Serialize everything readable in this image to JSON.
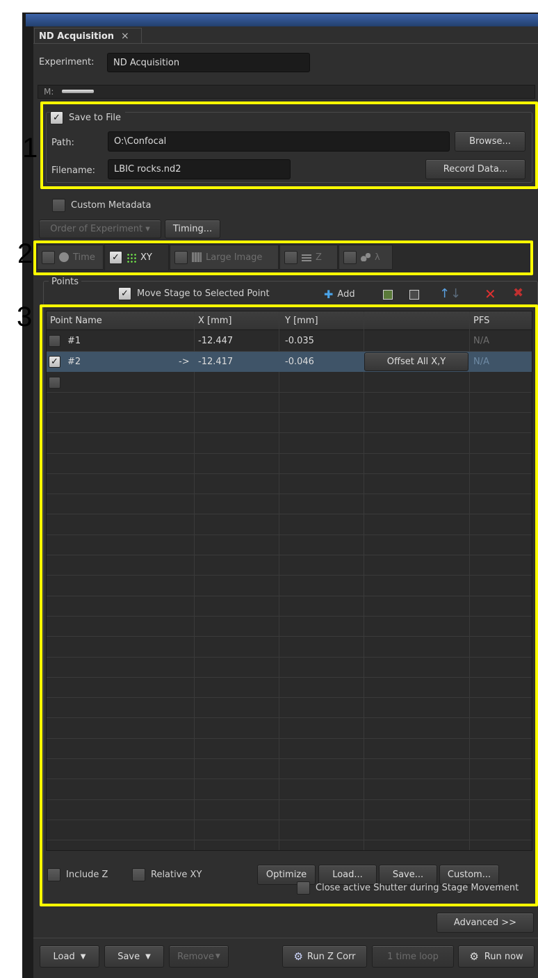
{
  "window": {
    "tab_title": "ND Acquisition",
    "tab_close": "×"
  },
  "experiment": {
    "label": "Experiment:",
    "value": "ND Acquisition",
    "m_label": "M:"
  },
  "save": {
    "checkbox_label": "Save to File",
    "checked": true,
    "path_label": "Path:",
    "path_value": "O:\\Confocal",
    "browse_label": "Browse...",
    "filename_label": "Filename:",
    "filename_value": "LBIC rocks.nd2",
    "record_label": "Record Data..."
  },
  "metadata": {
    "label": "Custom Metadata",
    "checked": false
  },
  "order": {
    "order_label": "Order of Experiment ▾",
    "timing_label": "Timing..."
  },
  "dimensions": {
    "time": "Time",
    "xy": "XY",
    "large": "Large Image",
    "z": "Z",
    "lambda": "λ"
  },
  "points": {
    "group_label": "Points",
    "move_stage_label": "Move Stage to Selected Point",
    "add_label": "Add",
    "columns": {
      "name": "Point Name",
      "x": "X [mm]",
      "y": "Y [mm]",
      "extra": "",
      "pfs": "PFS"
    },
    "rows": [
      {
        "name": "#1",
        "x": "-12.447",
        "y": "-0.035",
        "pfs": "N/A",
        "checked": false
      },
      {
        "name": "#2",
        "arrow": "->",
        "x": "-12.417",
        "y": "-0.046",
        "action": "Offset All X,Y",
        "pfs": "N/A",
        "checked": true
      }
    ],
    "include_z": "Include Z",
    "relative_xy": "Relative XY",
    "optimize": "Optimize",
    "load": "Load...",
    "save": "Save...",
    "custom": "Custom...",
    "close_shutter": "Close active Shutter during Stage Movement"
  },
  "footer": {
    "advanced": "Advanced >>",
    "load": "Load",
    "save": "Save",
    "remove": "Remove",
    "run_z": "Run Z Corr",
    "time_loop": "1 time loop",
    "run_now": "Run now"
  },
  "annotations": {
    "one": "1",
    "two": "2",
    "three": "3"
  },
  "colors": {
    "highlight": "#ffff00",
    "panel": "#2f2f2f",
    "selected_row": "#3f5468"
  }
}
